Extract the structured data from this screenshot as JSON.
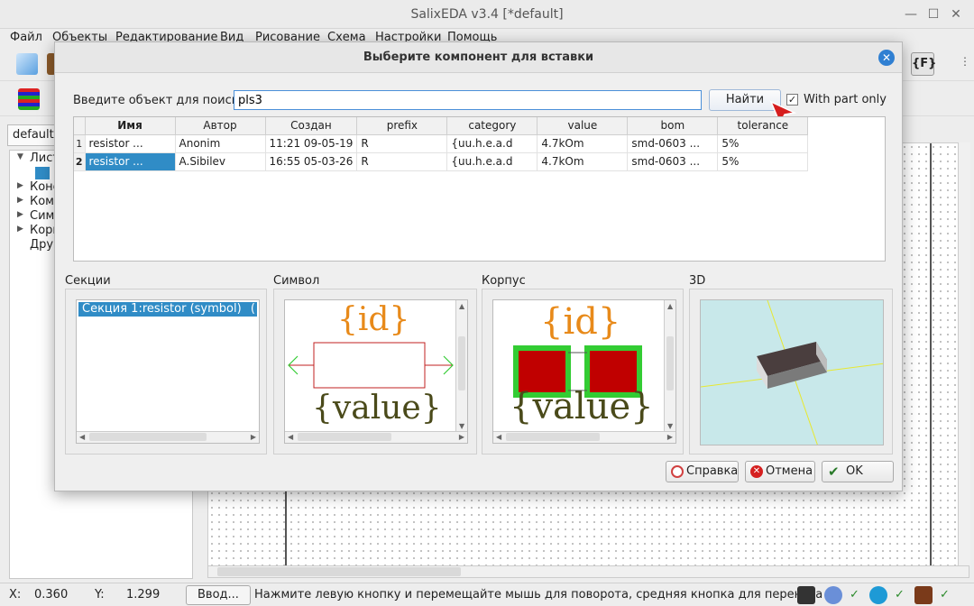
{
  "window": {
    "title": "SalixEDA v3.4 [*default]"
  },
  "menu": [
    "Файл",
    "Объекты",
    "Редактирование",
    "Вид",
    "Рисование",
    "Схема",
    "Настройки",
    "Помощь"
  ],
  "left": {
    "combo_value": "default",
    "tree": [
      "Лист",
      "Коне",
      "Ком",
      "Сим",
      "Корп",
      "Дру"
    ]
  },
  "dialog": {
    "title": "Выберите компонент для вставки",
    "search_label": "Введите объект для поиска:",
    "search_value": "pls3",
    "find_button": "Найти",
    "part_only_label": "With part only",
    "part_only_checked": "✓",
    "columns": [
      "Имя",
      "Автор",
      "Создан",
      "prefix",
      "category",
      "value",
      "bom",
      "tolerance"
    ],
    "rows": [
      {
        "num": "1",
        "cells": [
          "resistor ...",
          "Anonim",
          "11:21 09-05-19",
          "R",
          "{uu.h.e.a.d",
          "4.7kOm",
          "smd-0603 ...",
          "5%"
        ]
      },
      {
        "num": "2",
        "cells": [
          "resistor ...",
          "A.Sibilev",
          "16:55 05-03-26",
          "R",
          "{uu.h.e.a.d",
          "4.7kOm",
          "smd-0603 ...",
          "5%"
        ]
      }
    ],
    "selected_row": 2,
    "panes": {
      "sections_label": "Секции",
      "symbol_label": "Символ",
      "package_label": "Корпус",
      "view3d_label": "3D",
      "section_item": "Секция 1:resistor (symbol)",
      "section_item_suffix": "(",
      "symbol_id": "{id}",
      "symbol_value": "{value}",
      "package_id": "{id}",
      "package_value": "{value}"
    },
    "buttons": {
      "help": "Справка",
      "cancel": "Отмена",
      "ok": "OK"
    }
  },
  "status": {
    "x_label": "X:",
    "x_value": "0.360",
    "y_label": "Y:",
    "y_value": "1.299",
    "input_button": "Ввод...",
    "message": "Нажмите левую кнопку и перемещайте мышь для поворота, средняя кнопка для переноса",
    "checks": [
      "✓",
      "✓",
      "✓",
      "✓"
    ]
  },
  "colors": {
    "accent": "#308cc6",
    "pad_red": "#c00000",
    "pad_green": "#33cc33",
    "id_orange": "#e88a1a",
    "value_olive": "#4a4a1a",
    "view3d_bg": "#c8e8ea"
  }
}
